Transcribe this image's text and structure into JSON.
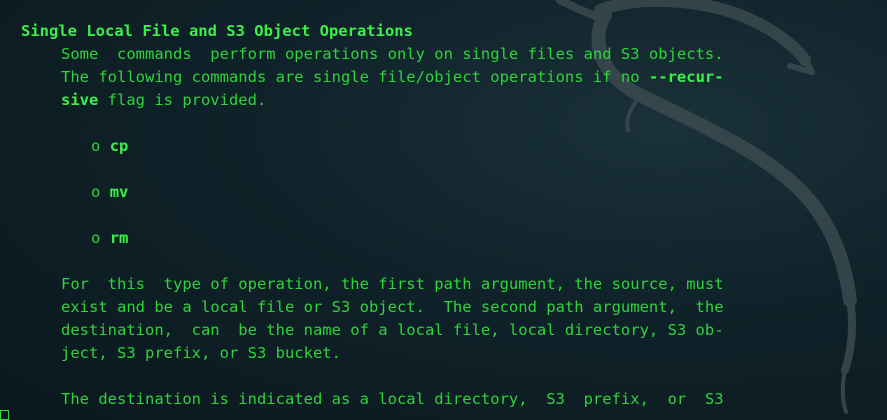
{
  "heading": "Single Local File and S3 Object Operations",
  "intro": {
    "line1": "Some  commands  perform operations only on single files and S3 objects.",
    "line2_pre": "The following commands are single file/object operations if no ",
    "flag_part1": "--recur-",
    "flag_part2": "sive",
    "line3_post": " flag is provided."
  },
  "bullet_marker": "o",
  "commands": [
    "cp",
    "mv",
    "rm"
  ],
  "para2": [
    "For  this  type of operation, the first path argument, the source, must",
    "exist and be a local file or S3 object.  The second path argument,  the",
    "destination,  can  be the name of a local file, local directory, S3 ob-",
    "ject, S3 prefix, or S3 bucket."
  ],
  "para3": [
    "The destination is indicated as a local directory,  S3  prefix,  or  S3"
  ],
  "colors": {
    "text": "#2fd43b",
    "bold_text": "#3cf04a",
    "background": "#0f2229",
    "dragon": "#3a4a50"
  },
  "decoration": "kali-dragon-watermark"
}
